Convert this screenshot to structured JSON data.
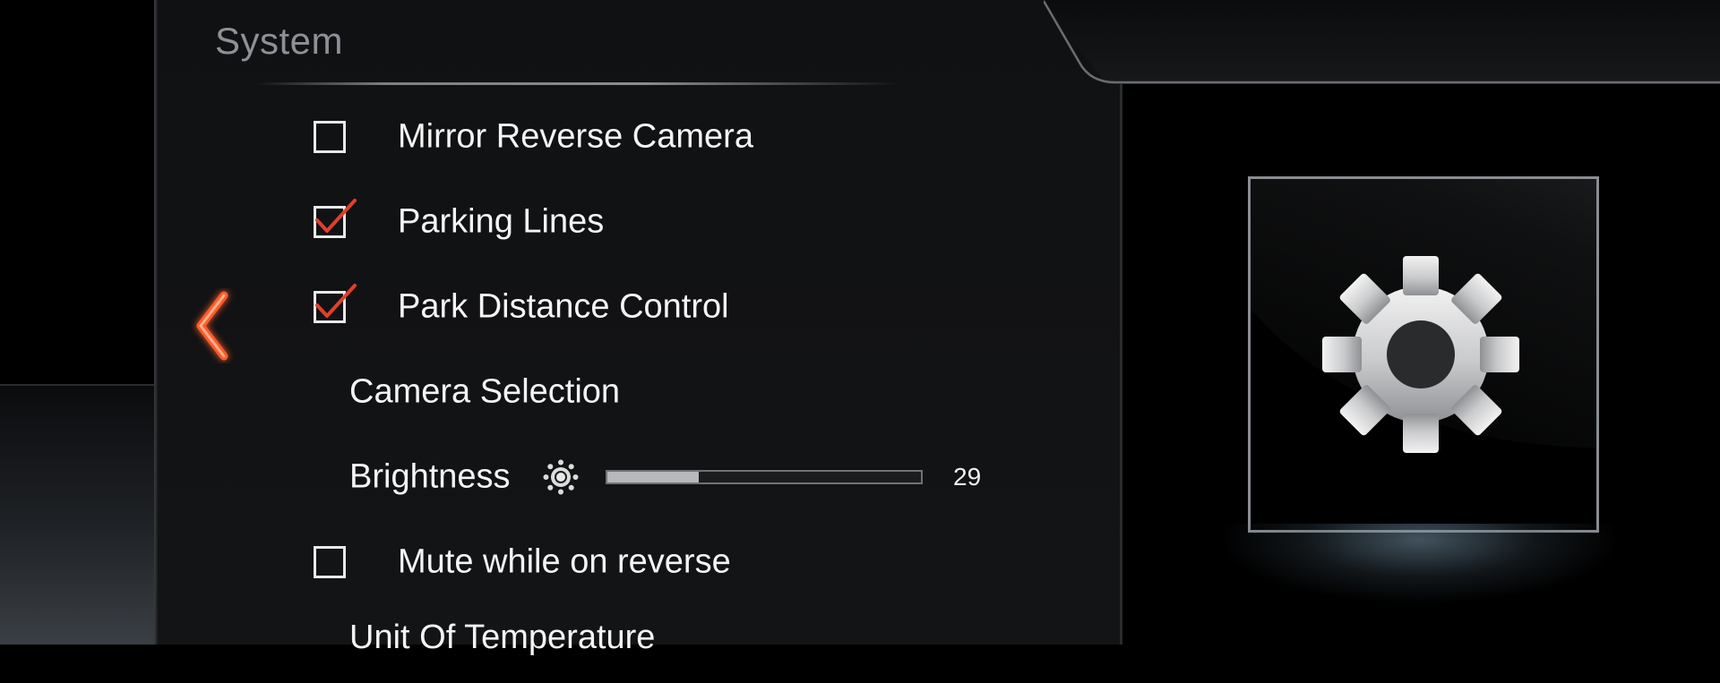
{
  "panel": {
    "title": "System"
  },
  "settings": [
    {
      "label": "Mirror Reverse Camera",
      "checked": false
    },
    {
      "label": "Parking Lines",
      "checked": true
    },
    {
      "label": "Park Distance Control",
      "checked": true
    },
    {
      "label": "Camera Selection"
    },
    {
      "label": "Brightness",
      "value": "29",
      "level_percent": 29
    },
    {
      "label": "Mute while on reverse",
      "checked": false
    },
    {
      "label": "Unit Of Temperature"
    }
  ],
  "colors": {
    "accent": "#e0402a",
    "checkmark": "#e0402a",
    "background": "#121315"
  },
  "icons": {
    "back": "chevron-left-icon",
    "category": "gear-icon",
    "brightness": "sun-icon"
  }
}
